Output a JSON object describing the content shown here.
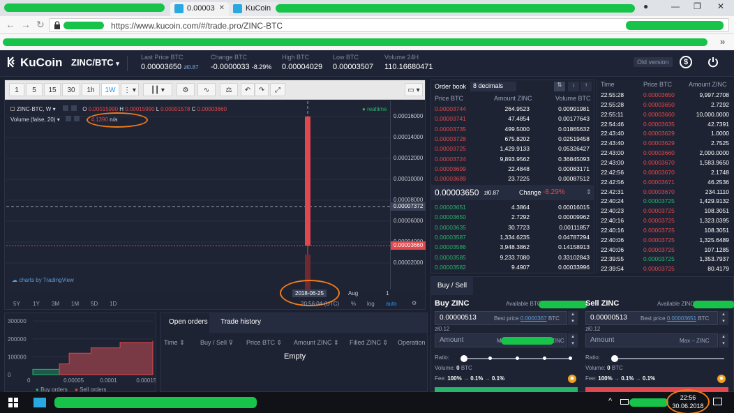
{
  "browser": {
    "tabs": [
      {
        "label": "0.00003",
        "active": true
      },
      {
        "label": "KuCoin",
        "active": false
      }
    ],
    "url": "https://www.kucoin.com/#/trade.pro/ZINC-BTC",
    "bookmark_chevron": "»"
  },
  "header": {
    "logo": "KuCoin",
    "pair": "ZINC/BTC",
    "last_price_label": "Last Price BTC",
    "last_price": "0.00003650",
    "last_price_fiat": "zł0.87",
    "change_label": "Change BTC",
    "change_value": "-0.0000033",
    "change_pct": "-8.29%",
    "high_label": "High BTC",
    "high_value": "0.00004029",
    "low_label": "Low BTC",
    "low_value": "0.00003507",
    "volume_label": "Volume 24H",
    "volume_value": "110.16680471",
    "old_version": "Old version",
    "currency_icon": "dollar-icon",
    "power_icon": "power-icon"
  },
  "chart": {
    "intervals": [
      "1",
      "5",
      "15",
      "30",
      "1h",
      "1W"
    ],
    "active_interval": "1W",
    "symbol_legend": "ZINC-BTC, W",
    "ohlc": {
      "o_label": "O",
      "o": "0.00015990",
      "h_label": "H",
      "h": "0.00015990",
      "l_label": "L",
      "l": "0.00001578",
      "c_label": "C",
      "c": "0.00003660"
    },
    "volume_legend": "Volume (false, 20)",
    "volume_value": "4.1390",
    "volume_extra": "n/a",
    "status": "realtime",
    "tradingview": "charts by TradingView",
    "current_price_tag": "0.00003660",
    "crosshair_tag": "0.00007372",
    "date_tag": "2018-06-25",
    "x_aug": "Aug",
    "x_partial": "1",
    "time_tag": "20:56:04 (UTC)",
    "ranges": [
      "5Y",
      "1Y",
      "3M",
      "1M",
      "5D",
      "1D"
    ],
    "pct_label": "%",
    "log_label": "log",
    "auto_label": "auto",
    "up_color": "#26b56b",
    "down_color": "#e0484d"
  },
  "chart_data": {
    "type": "bar",
    "title": "",
    "ylim": [
      0.0,
      0.000168
    ],
    "yticks": [
      "0.00016000",
      "0.00014000",
      "0.00012000",
      "0.00010000",
      "0.00008000",
      "0.00006000",
      "0.00004000",
      "0.00002000"
    ],
    "ytick_values": [
      0.00016,
      0.00014,
      0.00012,
      0.0001,
      8e-05,
      6e-05,
      4e-05,
      2e-05
    ],
    "candle": {
      "date": "2018-06-25",
      "open": 0.0001599,
      "high": 0.0001599,
      "low": 1.578e-05,
      "close": 3.66e-05
    },
    "current_price": 3.66e-05,
    "crosshair_price": 7.372e-05
  },
  "depth": {
    "yticks": [
      "300000",
      "200000",
      "100000",
      "0"
    ],
    "ytick_values": [
      300000,
      200000,
      100000,
      0
    ],
    "xticks": [
      "0",
      "0.00005",
      "0.0001",
      "0.00015"
    ],
    "xtick_values": [
      0,
      5e-05,
      0.0001,
      0.00015
    ],
    "xlim": [
      0,
      0.000165
    ],
    "ylim": [
      0,
      320000
    ],
    "buy_curve": [
      [
        0,
        30000
      ],
      [
        3.65e-05,
        8000
      ]
    ],
    "sell_curve": [
      [
        3.65e-05,
        60000
      ],
      [
        5e-05,
        120000
      ],
      [
        8e-05,
        150000
      ],
      [
        0.00012,
        180000
      ],
      [
        0.000165,
        190000
      ]
    ],
    "legend_buy": "Buy orders",
    "legend_sell": "Sell orders"
  },
  "orders": {
    "tab_open": "Open orders",
    "tab_history": "Trade history",
    "columns": [
      "Time",
      "Buy / Sell",
      "Price BTC",
      "Amount ZINC",
      "Filled ZINC",
      "Operation"
    ],
    "empty": "Empty"
  },
  "orderbook": {
    "title": "Order book",
    "decimals": "8 decimals",
    "col_price": "Price BTC",
    "col_amount": "Amount ZINC",
    "col_volume": "Volume BTC",
    "asks": [
      {
        "price": "0.00003744",
        "amount": "264.9523",
        "volume": "0.00991981"
      },
      {
        "price": "0.00003741",
        "amount": "47.4854",
        "volume": "0.00177643"
      },
      {
        "price": "0.00003735",
        "amount": "499.5000",
        "volume": "0.01865632"
      },
      {
        "price": "0.00003728",
        "amount": "675.8202",
        "volume": "0.02519458"
      },
      {
        "price": "0.00003725",
        "amount": "1,429.9133",
        "volume": "0.05326427"
      },
      {
        "price": "0.00003724",
        "amount": "9,893.9562",
        "volume": "0.36845093"
      },
      {
        "price": "0.00003699",
        "amount": "22.4848",
        "volume": "0.00083171"
      },
      {
        "price": "0.00003689",
        "amount": "23.7225",
        "volume": "0.00087512"
      }
    ],
    "mid_price": "0.00003650",
    "mid_fiat": "zł0.87",
    "mid_change_label": "Change",
    "mid_change": "-8.29%",
    "bids": [
      {
        "price": "0.00003651",
        "amount": "4.3864",
        "volume": "0.00016015"
      },
      {
        "price": "0.00003650",
        "amount": "2.7292",
        "volume": "0.00009962"
      },
      {
        "price": "0.00003635",
        "amount": "30.7723",
        "volume": "0.00111857"
      },
      {
        "price": "0.00003587",
        "amount": "1,334.6235",
        "volume": "0.04787294"
      },
      {
        "price": "0.00003586",
        "amount": "3,948.3862",
        "volume": "0.14158913"
      },
      {
        "price": "0.00003585",
        "amount": "9,233.7080",
        "volume": "0.33102843"
      },
      {
        "price": "0.00003582",
        "amount": "9.4907",
        "volume": "0.00033996"
      }
    ]
  },
  "trades": {
    "col_time": "Time",
    "col_price": "Price BTC",
    "col_amount": "Amount ZINC",
    "rows": [
      {
        "time": "22:55:28",
        "price": "0.00003650",
        "amount": "9,997.2708",
        "side": "sell"
      },
      {
        "time": "22:55:28",
        "price": "0.00003650",
        "amount": "2.7292",
        "side": "sell"
      },
      {
        "time": "22:55:11",
        "price": "0.00003660",
        "amount": "10,000.0000",
        "side": "sell"
      },
      {
        "time": "22:54:46",
        "price": "0.00003635",
        "amount": "42.7391",
        "side": "sell"
      },
      {
        "time": "22:43:40",
        "price": "0.00003629",
        "amount": "1.0000",
        "side": "sell"
      },
      {
        "time": "22:43:40",
        "price": "0.00003629",
        "amount": "2.7525",
        "side": "sell"
      },
      {
        "time": "22:43:00",
        "price": "0.00003660",
        "amount": "2,000.0000",
        "side": "sell"
      },
      {
        "time": "22:43:00",
        "price": "0.00003670",
        "amount": "1,583.9650",
        "side": "sell"
      },
      {
        "time": "22:42:56",
        "price": "0.00003670",
        "amount": "2.1748",
        "side": "sell"
      },
      {
        "time": "22:42:56",
        "price": "0.00003671",
        "amount": "46.2536",
        "side": "sell"
      },
      {
        "time": "22:42:31",
        "price": "0.00003670",
        "amount": "234.1110",
        "side": "sell"
      },
      {
        "time": "22:40:24",
        "price": "0.00003725",
        "amount": "1,429.9132",
        "side": "buy"
      },
      {
        "time": "22:40:23",
        "price": "0.00003725",
        "amount": "108.3051",
        "side": "sell"
      },
      {
        "time": "22:40:16",
        "price": "0.00003725",
        "amount": "1,323.0395",
        "side": "sell"
      },
      {
        "time": "22:40:16",
        "price": "0.00003725",
        "amount": "108.3051",
        "side": "sell"
      },
      {
        "time": "22:40:06",
        "price": "0.00003725",
        "amount": "1,325.6489",
        "side": "sell"
      },
      {
        "time": "22:40:06",
        "price": "0.00003725",
        "amount": "107.1285",
        "side": "sell"
      },
      {
        "time": "22:39:55",
        "price": "0.00003725",
        "amount": "1,353.7937",
        "side": "buy"
      },
      {
        "time": "22:39:54",
        "price": "0.00003725",
        "amount": "80.4179",
        "side": "sell"
      }
    ]
  },
  "buysell": {
    "tab": "Buy / Sell",
    "buy_title": "Buy ZINC",
    "buy_available": "Available BTC",
    "buy_price": "0.00000513",
    "buy_best_label": "Best price",
    "buy_best_price": "0.0000367",
    "buy_unit": "BTC",
    "buy_fiat": "zł0.12",
    "buy_amount_placeholder": "Amount",
    "buy_max": "Max",
    "buy_amount_unit": "ZINC",
    "ratio_label": "Ratio:",
    "buy_volume_label": "Volume:",
    "buy_volume": "0",
    "buy_volume_unit": "BTC",
    "fee_label": "Fee:",
    "fee_values": [
      "100%",
      "0.1%",
      "0.1%"
    ],
    "fee_arrow": "→",
    "sell_title": "Sell ZINC",
    "sell_available": "Available ZINC",
    "sell_price": "0.00000513",
    "sell_best_label": "Best price",
    "sell_best_price": "0.00003651",
    "sell_unit": "BTC",
    "sell_fiat": "zł0.12",
    "sell_amount_placeholder": "Amount",
    "sell_max": "Max",
    "sell_max_sep": "–",
    "sell_amount_unit": "ZINC",
    "sell_volume_label": "Volume:",
    "sell_volume": "0",
    "sell_volume_unit": "BTC",
    "buy_color": "#26b56b",
    "sell_color": "#e0484d"
  },
  "taskbar": {
    "clock_time": "22:56",
    "clock_date": "30.06.2018"
  }
}
